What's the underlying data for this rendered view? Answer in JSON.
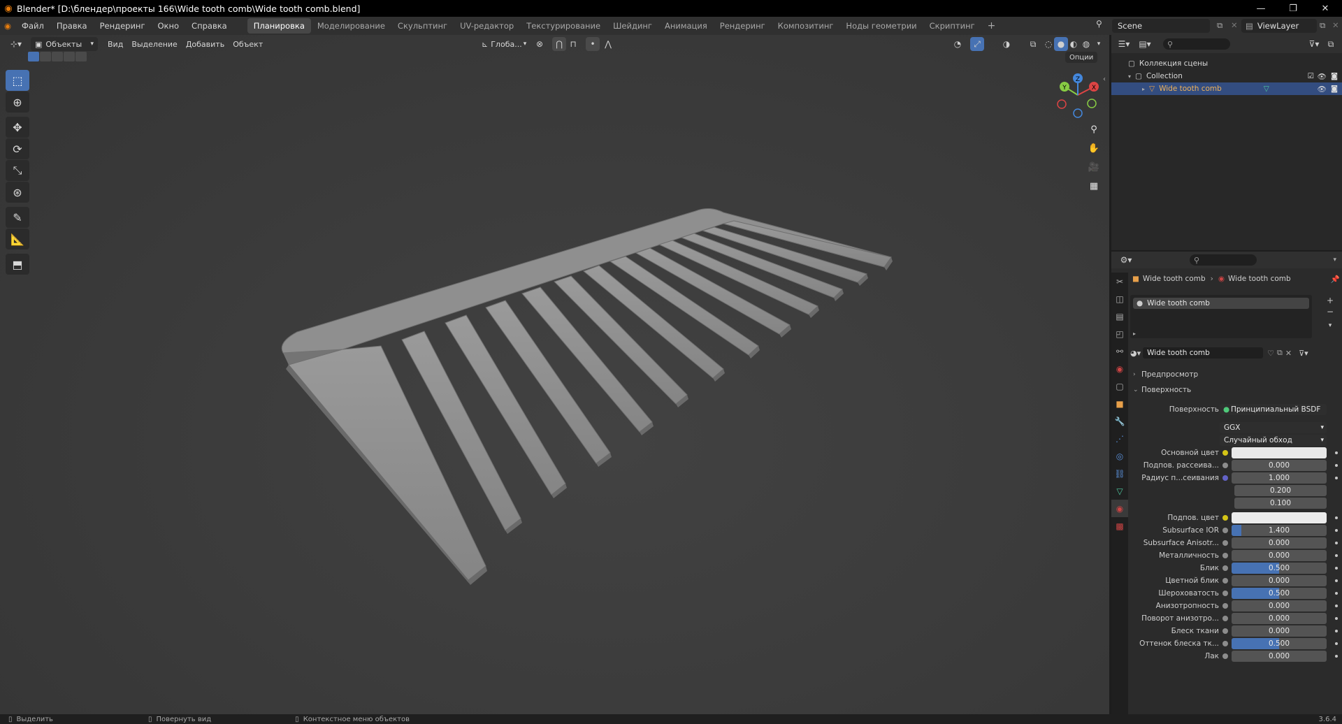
{
  "window": {
    "title": "Blender* [D:\\блендер\\проекты 166\\Wide tooth comb\\Wide tooth comb.blend]",
    "controls": [
      "—",
      "❐",
      "✕"
    ]
  },
  "menu": [
    "Файл",
    "Правка",
    "Рендеринг",
    "Окно",
    "Справка"
  ],
  "workspaces": [
    {
      "label": "Планировка",
      "active": true
    },
    {
      "label": "Моделирование"
    },
    {
      "label": "Скульптинг"
    },
    {
      "label": "UV-редактор"
    },
    {
      "label": "Текстурирование"
    },
    {
      "label": "Шейдинг"
    },
    {
      "label": "Анимация"
    },
    {
      "label": "Рендеринг"
    },
    {
      "label": "Композитинг"
    },
    {
      "label": "Ноды геометрии"
    },
    {
      "label": "Скриптинг"
    }
  ],
  "scene": {
    "name": "Scene",
    "view_layer": "ViewLayer"
  },
  "viewport": {
    "mode": "Объекты",
    "menus": [
      "Вид",
      "Выделение",
      "Добавить",
      "Объект"
    ],
    "transform_orientation": "Глоба...",
    "options_label": "Опции",
    "gizmo": {
      "x": "X",
      "y": "Y",
      "z": "Z"
    }
  },
  "outliner": {
    "scene_collection": "Коллекция сцены",
    "collection": "Collection",
    "object": "Wide tooth comb"
  },
  "properties": {
    "breadcrumb_object": "Wide tooth comb",
    "breadcrumb_material": "Wide tooth comb",
    "slot": "Wide tooth comb",
    "material_name": "Wide tooth comb",
    "preview_panel": "Предпросмотр",
    "surface_panel": "Поверхность",
    "surface_label": "Поверхность",
    "surface_shader": "Принципиальный BSDF",
    "distribution": "GGX",
    "subsurface_method": "Случайный обход",
    "rows": [
      {
        "label": "Основной цвет",
        "type": "color",
        "color": "#e8e8e8",
        "dot": "#d4c416"
      },
      {
        "label": "Подпов. рассеива...",
        "value": "0.000",
        "fill": 0,
        "dot": "#8c8c8c"
      },
      {
        "label": "Радиус п...сеивания",
        "value": "1.000",
        "fill": 0,
        "dot": "#6363c7"
      },
      {
        "label": "",
        "value": "0.200",
        "fill": 0
      },
      {
        "label": "",
        "value": "0.100",
        "fill": 0
      },
      {
        "label": "Подпов. цвет",
        "type": "color",
        "color": "#ececec",
        "dot": "#d4c416"
      },
      {
        "label": "Subsurface IOR",
        "value": "1.400",
        "fill": 0.1,
        "dot": "#8c8c8c"
      },
      {
        "label": "Subsurface Anisotr...",
        "value": "0.000",
        "fill": 0,
        "dot": "#8c8c8c"
      },
      {
        "label": "Металличность",
        "value": "0.000",
        "fill": 0,
        "dot": "#8c8c8c"
      },
      {
        "label": "Блик",
        "value": "0.500",
        "fill": 0.5,
        "dot": "#8c8c8c"
      },
      {
        "label": "Цветной блик",
        "value": "0.000",
        "fill": 0,
        "dot": "#8c8c8c"
      },
      {
        "label": "Шероховатость",
        "value": "0.500",
        "fill": 0.5,
        "dot": "#8c8c8c"
      },
      {
        "label": "Анизотропность",
        "value": "0.000",
        "fill": 0,
        "dot": "#8c8c8c"
      },
      {
        "label": "Поворот анизотро...",
        "value": "0.000",
        "fill": 0,
        "dot": "#8c8c8c"
      },
      {
        "label": "Блеск ткани",
        "value": "0.000",
        "fill": 0,
        "dot": "#8c8c8c"
      },
      {
        "label": "Оттенок блеска тк...",
        "value": "0.500",
        "fill": 0.5,
        "dot": "#8c8c8c"
      },
      {
        "label": "Лак",
        "value": "0.000",
        "fill": 0,
        "dot": "#8c8c8c"
      }
    ]
  },
  "statusbar": {
    "select": "Выделить",
    "rotate": "Повернуть вид",
    "context": "Контекстное меню объектов",
    "version": "3.6.4"
  },
  "colors": {
    "accent": "#4772b3",
    "selection": "#334d80",
    "object_orange": "#e8a04a"
  }
}
